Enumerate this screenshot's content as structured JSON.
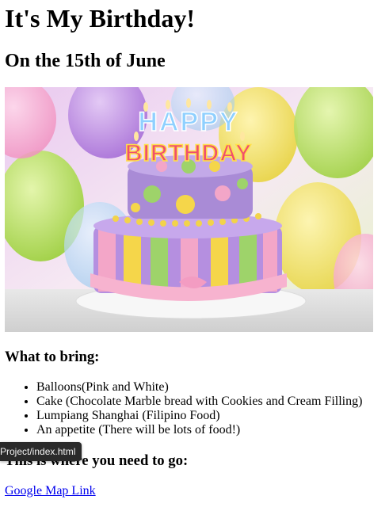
{
  "page": {
    "title": "It's My Birthday!",
    "subtitle": "On the 15th of June",
    "image": {
      "alt": "Birthday cake with HAPPY BIRTHDAY candles",
      "candle_top": "HAPPY",
      "candle_bottom": "BIRTHDAY"
    },
    "bring": {
      "heading": "What to bring:",
      "items": [
        "Balloons(Pink and White)",
        "Cake (Chocolate Marble bread with Cookies and Cream Filling)",
        "Lumpiang Shanghai (Filipino Food)",
        "An appetite (There will be lots of food!)"
      ]
    },
    "directions": {
      "heading": "This is where you need to go:",
      "link_text": "Google Map Link"
    }
  },
  "status_tooltip": {
    "text": "Project/index.html"
  },
  "colors": {
    "link": "#0000ee",
    "tooltip_bg": "#2a2a2a",
    "cake_purple": "#a98bd6",
    "cake_pink": "#f3a6c8",
    "cake_yellow": "#f5d64a",
    "cake_green": "#9ed36a"
  }
}
